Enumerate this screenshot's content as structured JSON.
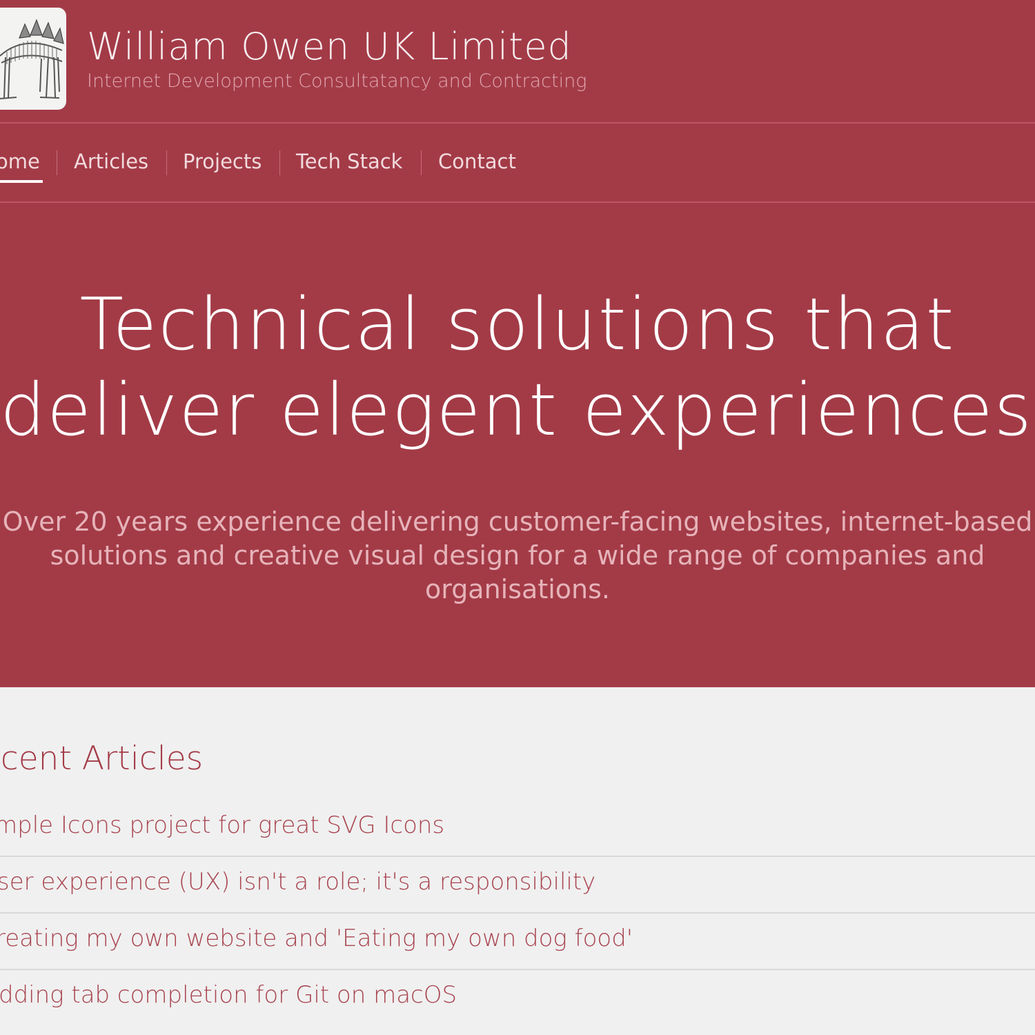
{
  "colors": {
    "brand": "#a33b47",
    "hero_text": "#e6b3b9",
    "page_background": "#f0f0f0"
  },
  "header": {
    "logo_icon": "stegosaurus-skeleton-illustration",
    "title": "William Owen UK Limited",
    "tagline": "Internet Development Consultatancy and Contracting"
  },
  "nav": {
    "items": [
      {
        "label": "ome",
        "active": true
      },
      {
        "label": "Articles"
      },
      {
        "label": "Projects"
      },
      {
        "label": "Tech Stack"
      },
      {
        "label": "Contact"
      }
    ]
  },
  "hero": {
    "heading_line1": "Technical solutions that",
    "heading_line2": "deliver elegent experiences.",
    "text_line1": "Over 20 years experience delivering customer-facing websites, internet-based",
    "text_line2": "solutions and creative visual design for a wide range of companies and",
    "text_line3": "organisations."
  },
  "recent": {
    "heading": "ecent Articles",
    "articles": [
      {
        "title": "mple Icons project for great SVG Icons"
      },
      {
        "title": "ser experience (UX) isn't a role; it's a responsibility"
      },
      {
        "title": "reating my own website and 'Eating my own dog food'"
      },
      {
        "title": "dding tab completion for Git on macOS"
      }
    ]
  }
}
